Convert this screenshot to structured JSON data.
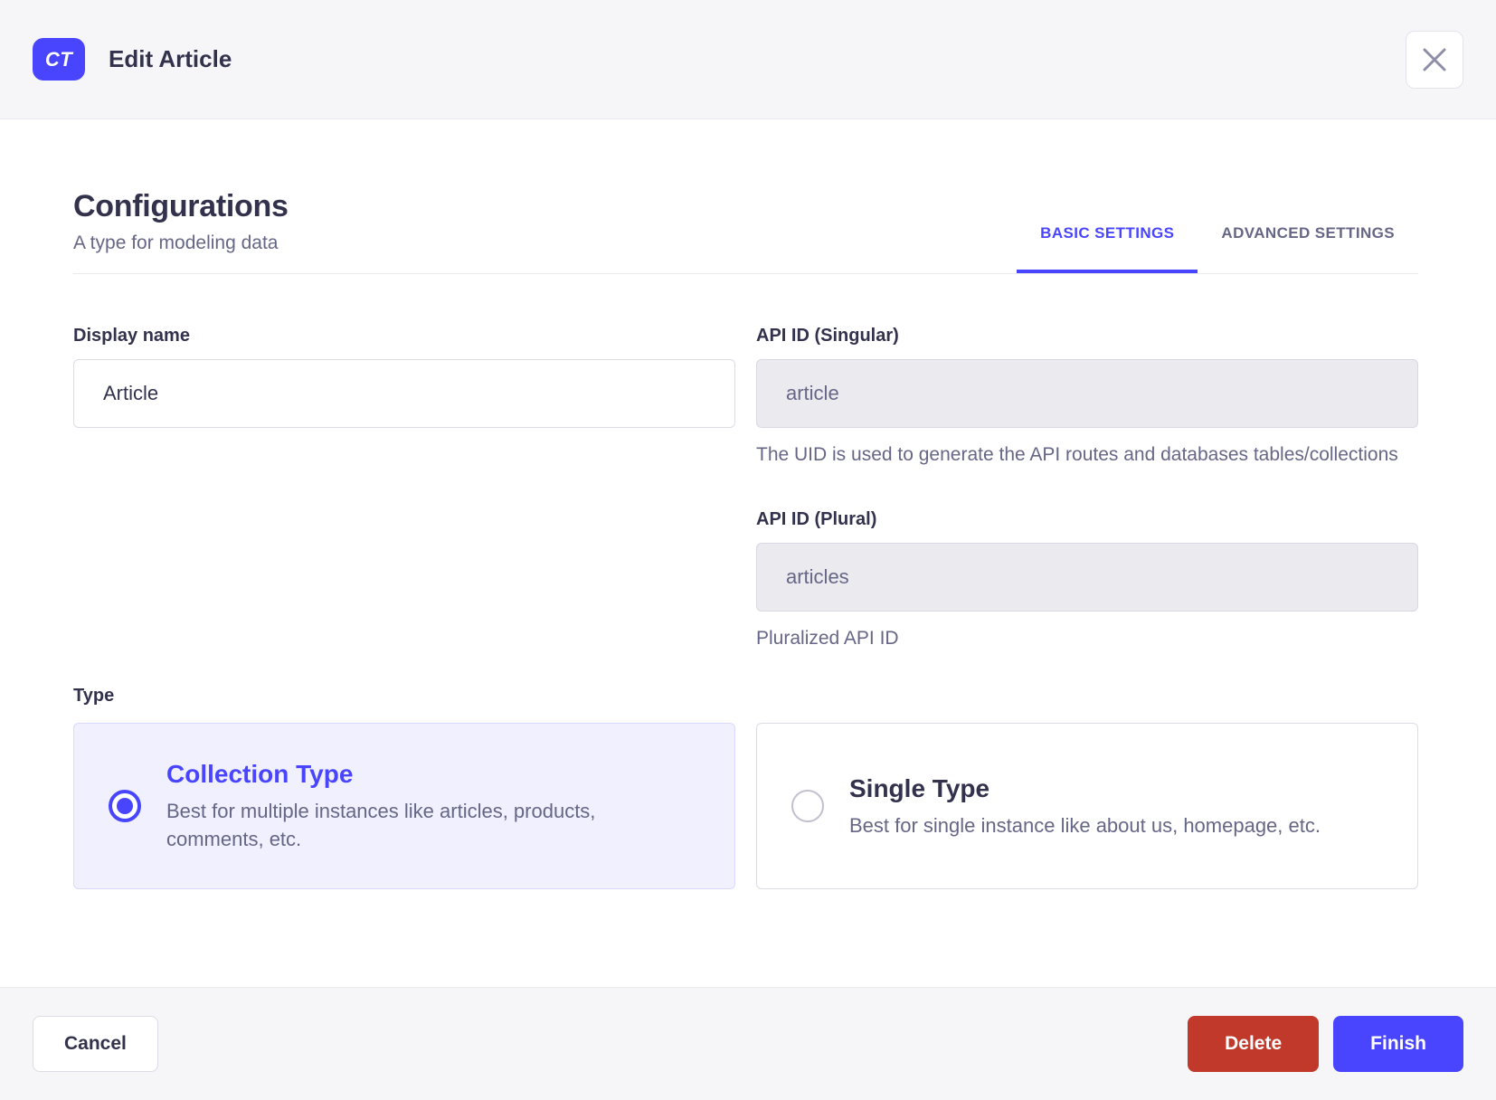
{
  "header": {
    "badge": "CT",
    "title": "Edit Article"
  },
  "page": {
    "title": "Configurations",
    "subtitle": "A type for modeling data"
  },
  "tabs": [
    {
      "label": "BASIC SETTINGS",
      "active": true
    },
    {
      "label": "ADVANCED SETTINGS",
      "active": false
    }
  ],
  "form": {
    "display_name": {
      "label": "Display name",
      "value": "Article"
    },
    "api_id_singular": {
      "label": "API ID (Singular)",
      "value": "article",
      "hint": "The UID is used to generate the API routes and databases tables/collections"
    },
    "api_id_plural": {
      "label": "API ID (Plural)",
      "value": "articles",
      "hint": "Pluralized API ID"
    },
    "type": {
      "label": "Type",
      "options": [
        {
          "title": "Collection Type",
          "description": "Best for multiple instances like articles, products, comments, etc.",
          "selected": true
        },
        {
          "title": "Single Type",
          "description": "Best for single instance like about us, homepage, etc.",
          "selected": false
        }
      ]
    }
  },
  "footer": {
    "cancel_label": "Cancel",
    "delete_label": "Delete",
    "finish_label": "Finish"
  },
  "colors": {
    "primary": "#4945ff",
    "primary_selected_bg": "#f0f0ff",
    "danger": "#c0392b",
    "header_bg": "#f6f6f9",
    "text": "#32324d",
    "text_muted": "#666687",
    "border": "#dcdce4",
    "disabled_input_bg": "#eaeaef"
  }
}
